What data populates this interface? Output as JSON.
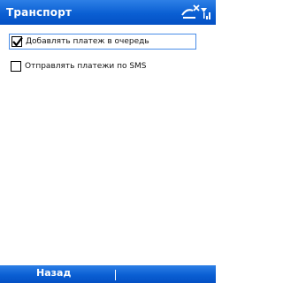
{
  "titlebar": {
    "title": "Транспорт",
    "icons": [
      "connectivity-icon",
      "signal-strength-icon"
    ]
  },
  "options": [
    {
      "label": "Добавлять платеж в очередь",
      "checked": true,
      "focused": true
    },
    {
      "label": "Отправлять платежи по SMS",
      "checked": false,
      "focused": false
    }
  ],
  "menubar": {
    "left_softkey": "Назад"
  },
  "colors": {
    "bar": "#0a5fd3",
    "focus_border": "#4a8de8"
  }
}
